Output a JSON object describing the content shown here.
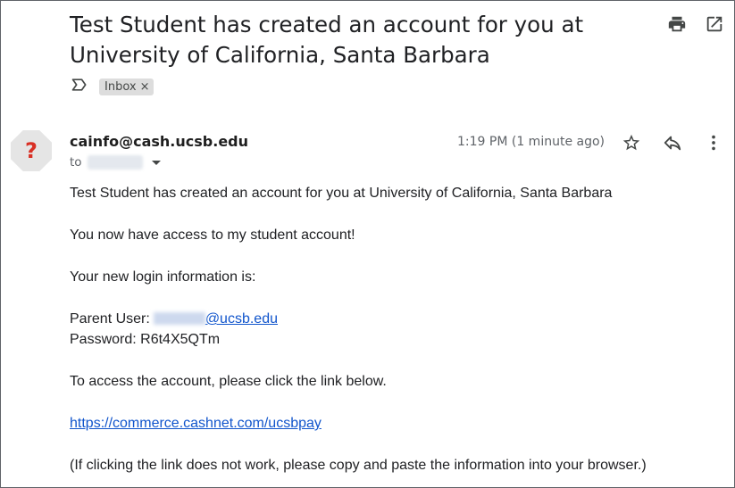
{
  "email": {
    "subject_line1": "Test Student has created an account for you at",
    "subject_line2": "University of California, Santa Barbara",
    "label": "Inbox",
    "label_remove": "×",
    "sender": "cainfo@cash.ucsb.edu",
    "to_label": "to",
    "time": "1:19 PM (1 minute ago)",
    "avatar_glyph": "?",
    "body": {
      "line1": "Test Student has created an account for you at University of California, Santa Barbara",
      "line2": "You now have access to my student account!",
      "line3": "Your new login information is:",
      "parent_user_label": "Parent User:",
      "parent_user_email_domain": "@ucsb.edu",
      "password_line": "Password: R6t4X5QTm",
      "line6": "To access the account, please click the link below.",
      "link": "https://commerce.cashnet.com/ucsbpay",
      "line8": "(If clicking the link does not work, please copy and paste the information into your browser.)"
    }
  },
  "icons": [
    "print-icon",
    "open-in-new-window-icon",
    "importance-marker-icon",
    "star-icon",
    "reply-icon",
    "more-vert-icon"
  ],
  "colors": {
    "link": "#1155cc",
    "avatar_glyph": "#d93025",
    "label_chip": "#dddddd"
  }
}
